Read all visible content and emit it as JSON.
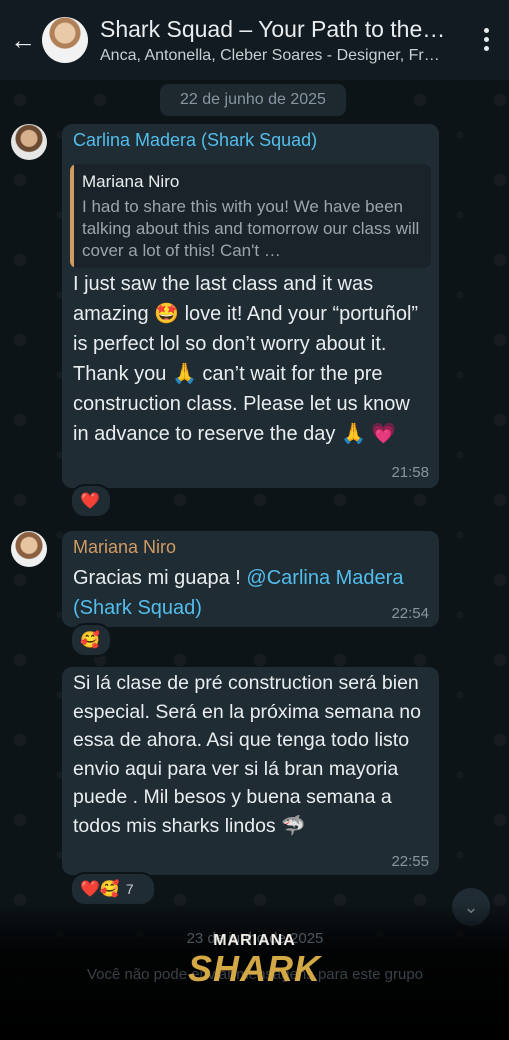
{
  "header": {
    "title": "Shark Squad – Your Path to the…",
    "members": "Anca, Antonella, Cleber Soares - Designer, Fr…"
  },
  "date_divider": "22 de junho de 2025",
  "messages": [
    {
      "sender": "Carlina Madera (Shark Squad)",
      "quote_author": "Mariana Niro",
      "quote_text": "I had to share this with you! We have been talking about this and tomorrow our class will cover a lot of this! Can't …",
      "text": "I just saw the last class and it was amazing 🤩 love it! And your “portuñol” is perfect lol so don’t worry about it. Thank you 🙏 can’t wait for the pre construction class. Please let us know in advance to reserve the day 🙏 💗",
      "time": "21:58",
      "reaction": "❤️"
    },
    {
      "sender": "Mariana Niro",
      "text_prefix": "Gracias mi guapa ! ",
      "mention": "@Carlina Madera (Shark Squad)",
      "time": "22:54",
      "reaction": "🥰"
    },
    {
      "text": "Si lá clase de pré construction será bien especial. Será en la próxima semana no essa de ahora. Asi que tenga todo listo envio aqui para ver si lá bran mayoria puede . Mil besos y buena semana a todos mis sharks lindos 🦈",
      "time": "22:55",
      "reaction_heart": "❤️",
      "reaction_face": "🥰",
      "reaction_count": "7"
    }
  ],
  "footer": {
    "faded_date": "23 de junho de 2025",
    "faded_note": "Você não pode enviar mensagens para este grupo",
    "logo_top": "MARIANA",
    "logo_main": "SHARK"
  }
}
